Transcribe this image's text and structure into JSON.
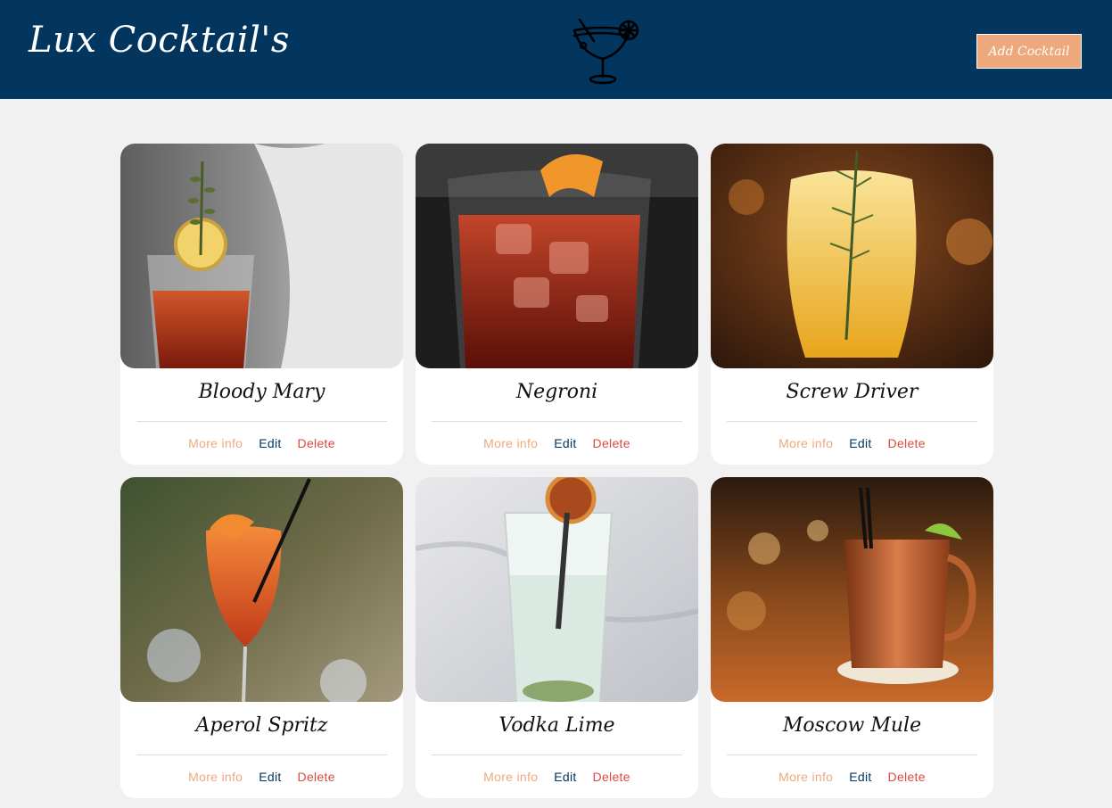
{
  "header": {
    "brand": "Lux Cocktail's",
    "add_button_label": "Add Cocktail",
    "logo_icon": "cocktail-glass-icon"
  },
  "cards": [
    {
      "name": "Bloody Mary",
      "more": "More info",
      "edit": "Edit",
      "delete": "Delete"
    },
    {
      "name": "Negroni",
      "more": "More info",
      "edit": "Edit",
      "delete": "Delete"
    },
    {
      "name": "Screw Driver",
      "more": "More info",
      "edit": "Edit",
      "delete": "Delete"
    },
    {
      "name": "Aperol Spritz",
      "more": "More info",
      "edit": "Edit",
      "delete": "Delete"
    },
    {
      "name": "Vodka Lime",
      "more": "More info",
      "edit": "Edit",
      "delete": "Delete"
    },
    {
      "name": "Moscow Mule",
      "more": "More info",
      "edit": "Edit",
      "delete": "Delete"
    }
  ],
  "colors": {
    "header_bg": "#03365f",
    "accent": "#eda97b",
    "edit": "#03365f",
    "delete": "#d94b3f",
    "page_bg": "#f1f1f1"
  }
}
